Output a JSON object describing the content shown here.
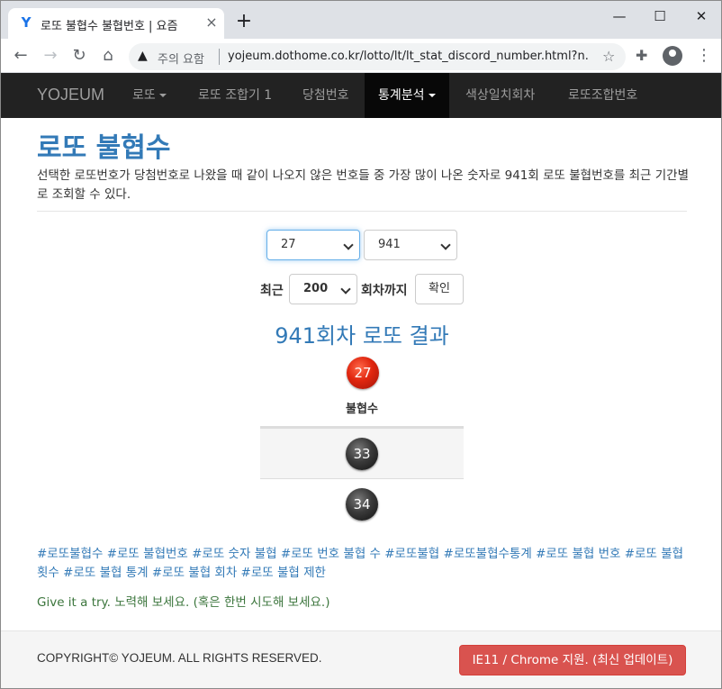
{
  "browser": {
    "tab_title": "로또 불협수 불협번호 | 요즘",
    "tab_favicon": "Y",
    "new_tab": "+",
    "win_minimize": "—",
    "win_maximize": "☐",
    "win_close": "✕",
    "security_label": "주의 요함",
    "url": "yojeum.dothome.co.kr/lotto/lt/lt_stat_discord_number.html?n...",
    "icons": [
      "back-arrow-icon",
      "forward-arrow-icon",
      "reload-icon",
      "home-icon",
      "warning-icon",
      "star-icon",
      "extensions-icon",
      "profile-icon",
      "menu-icon"
    ]
  },
  "navbar": {
    "brand": "YOJEUM",
    "items": [
      {
        "label": "로또",
        "dropdown": true
      },
      {
        "label": "로또 조합기 1",
        "dropdown": false
      },
      {
        "label": "당첨번호",
        "dropdown": false
      },
      {
        "label": "통계분석",
        "dropdown": true,
        "active": true
      },
      {
        "label": "색상일치회차",
        "dropdown": false
      },
      {
        "label": "로또조합번호",
        "dropdown": false
      }
    ]
  },
  "main": {
    "title": "로또 불협수",
    "description": "선택한 로또번호가 당첨번호로 나왔을 때 같이 나오지 않은 번호들 중 가장 많이 나온 숫자로 941회 로또 불협번호를 최근 기간별로 조회할 수 있다.",
    "number_select_value": "27",
    "round_select_value": "941",
    "recent_label": "최근",
    "recent_select_value": "200",
    "until_label": "회차까지",
    "confirm_button": "확인",
    "result_title": "941회차 로또 결과",
    "selected_ball": "27",
    "table_header": "불협수",
    "discord_numbers": [
      "33",
      "34"
    ],
    "tags": "#로또불협수 #로또 불협번호 #로또 숫자 불협 #로또 번호 불협 수 #로또불협 #로또불협수통계 #로또 불협 번호 #로또 불협 횟수 #로또 불협 통계 #로또 불협 회차 #로또 불협 제한",
    "try_message": "Give it a try. 노력해 보세요. (혹은 한번 시도해 보세요.)"
  },
  "footer": {
    "copyright": "COPYRIGHT© YOJEUM. ALL RIGHTS RESERVED.",
    "support_button": "IE11 / Chrome 지원. (최신 업데이트)"
  },
  "colors": {
    "link_blue": "#337ab7",
    "navbar_bg": "#222222",
    "ball_red": "#e0260f",
    "ball_dark": "#3a3a3a",
    "success_green": "#3c763d",
    "danger_button": "#d9534f"
  }
}
